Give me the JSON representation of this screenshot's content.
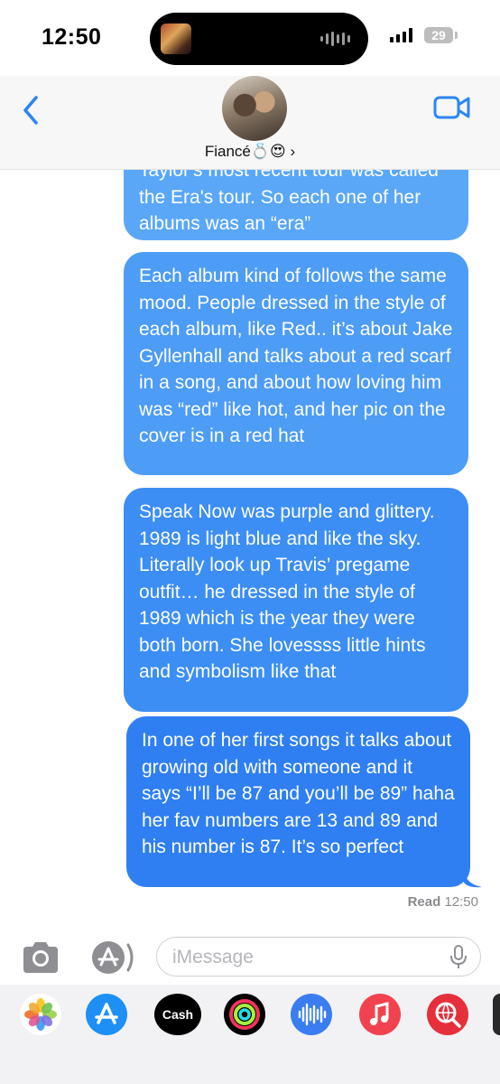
{
  "status_bar": {
    "time": "12:50",
    "battery_level": "29",
    "icons": [
      "now-playing-art",
      "audio-waveform-icon",
      "signal-bars-icon",
      "battery-icon"
    ]
  },
  "header": {
    "contact_name": "Fiancé💍😍 ›",
    "icons": [
      "back-chevron-icon",
      "contact-avatar",
      "video-camera-icon"
    ]
  },
  "messages": [
    {
      "sender": "me",
      "text": "Taylor's most recent tour was called the Era's tour. So each one of her albums was an “era”"
    },
    {
      "sender": "me",
      "text": "Each album kind of follows the same mood. People dressed in the style of each album, like Red.. it’s about Jake Gyllenhall and talks about a red scarf in a song, and about how loving him was “red” like hot, and her pic on the cover is in a red hat"
    },
    {
      "sender": "me",
      "text": "Speak Now was purple and glittery. 1989 is light blue and like the sky. Literally look up Travis’ pregame outfit… he dressed in the style of 1989 which is the year they were both born. She lovessss little hints and symbolism like that"
    },
    {
      "sender": "me",
      "text": "In one of her first songs it talks about growing old with someone and it says “I’ll be 87 and you’ll be 89” haha her fav numbers are 13 and 89 and his number is 87. It’s so perfect"
    }
  ],
  "read_receipt": {
    "label": "Read",
    "time": "12:50"
  },
  "input": {
    "placeholder": "iMessage"
  },
  "app_drawer": {
    "cash_label": "Cash",
    "apps": [
      "photos-app",
      "app-store-app",
      "apple-cash-app",
      "fitness-app",
      "audio-message-app",
      "music-app",
      "image-search-app"
    ]
  },
  "colors": {
    "bubble_top": "#5aa7f8",
    "bubble_bottom": "#2f7ff2",
    "accent": "#1d8ff5",
    "drawer_bg": "#f2f2f4"
  }
}
